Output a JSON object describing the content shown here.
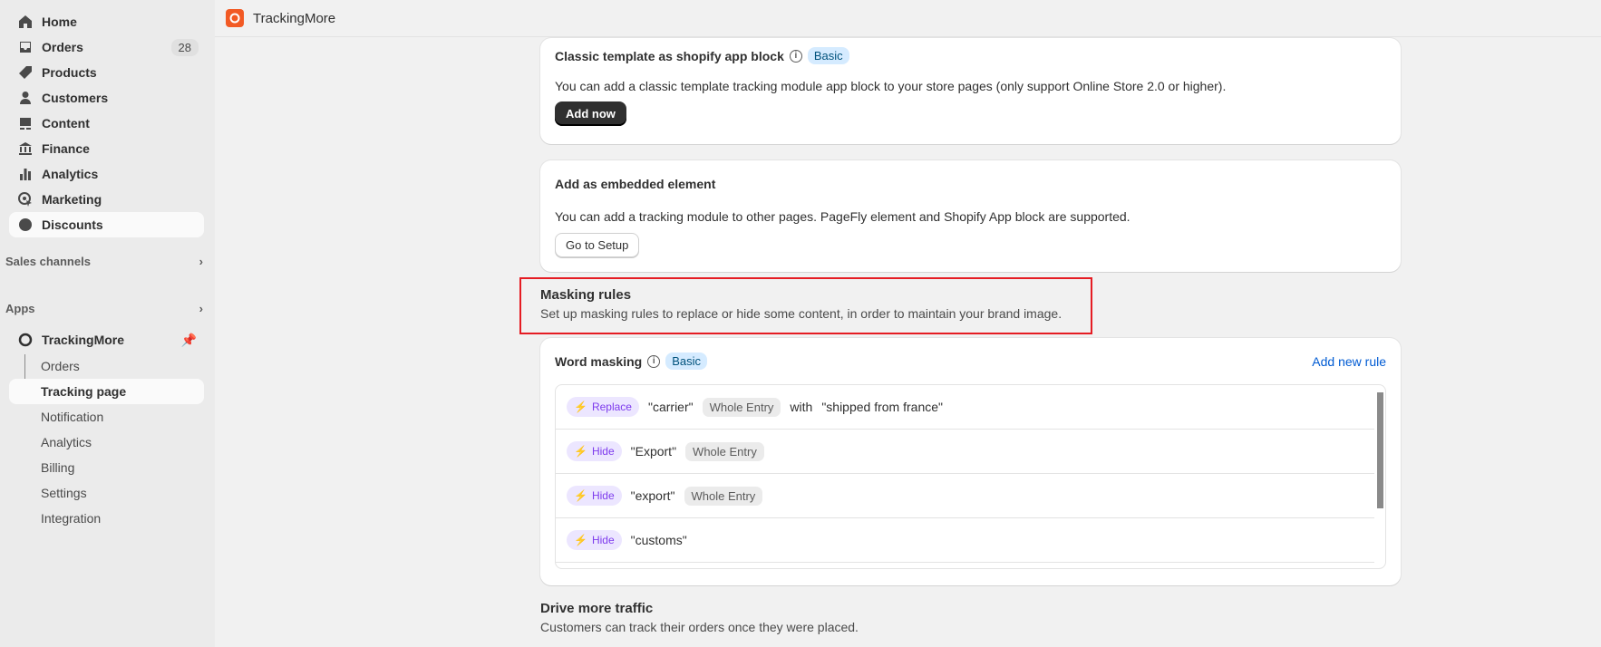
{
  "sidebar": {
    "items": [
      {
        "label": "Home",
        "icon": "home-icon"
      },
      {
        "label": "Orders",
        "icon": "orders-icon",
        "badge": "28"
      },
      {
        "label": "Products",
        "icon": "tag-icon"
      },
      {
        "label": "Customers",
        "icon": "person-icon"
      },
      {
        "label": "Content",
        "icon": "content-icon"
      },
      {
        "label": "Finance",
        "icon": "bank-icon"
      },
      {
        "label": "Analytics",
        "icon": "bar-chart-icon"
      },
      {
        "label": "Marketing",
        "icon": "target-icon"
      },
      {
        "label": "Discounts",
        "icon": "discount-icon"
      }
    ],
    "sales_channels": "Sales channels",
    "apps": "Apps",
    "app_name": "TrackingMore",
    "app_sub": [
      "Orders",
      "Tracking page",
      "Notification",
      "Analytics",
      "Billing",
      "Settings",
      "Integration"
    ]
  },
  "header": {
    "title": "TrackingMore"
  },
  "classic": {
    "title": "Classic template as shopify app block",
    "badge": "Basic",
    "desc": "You can add a classic template tracking module app block to your store pages (only support Online Store 2.0 or higher).",
    "button": "Add now"
  },
  "embedded": {
    "title": "Add as embedded element",
    "desc": "You can add a tracking module to other pages. PageFly element and Shopify App block are supported.",
    "button": "Go to Setup"
  },
  "masking": {
    "title": "Masking rules",
    "desc": "Set up masking rules to replace or hide some content, in order to maintain your brand image."
  },
  "word_masking": {
    "title": "Word masking",
    "badge": "Basic",
    "add": "Add new rule",
    "rules": [
      {
        "action": "Replace",
        "word": "\"carrier\"",
        "scope": "Whole Entry",
        "with": "with",
        "replacement": "\"shipped from france\""
      },
      {
        "action": "Hide",
        "word": "\"Export\"",
        "scope": "Whole Entry"
      },
      {
        "action": "Hide",
        "word": "\"export\"",
        "scope": "Whole Entry"
      },
      {
        "action": "Hide",
        "word": "\"customs\""
      }
    ]
  },
  "traffic": {
    "title": "Drive more traffic",
    "desc": "Customers can track their orders once they were placed."
  },
  "colors": {
    "accent": "#f25a24",
    "highlight": "#e51c23",
    "link": "#005bd3"
  }
}
